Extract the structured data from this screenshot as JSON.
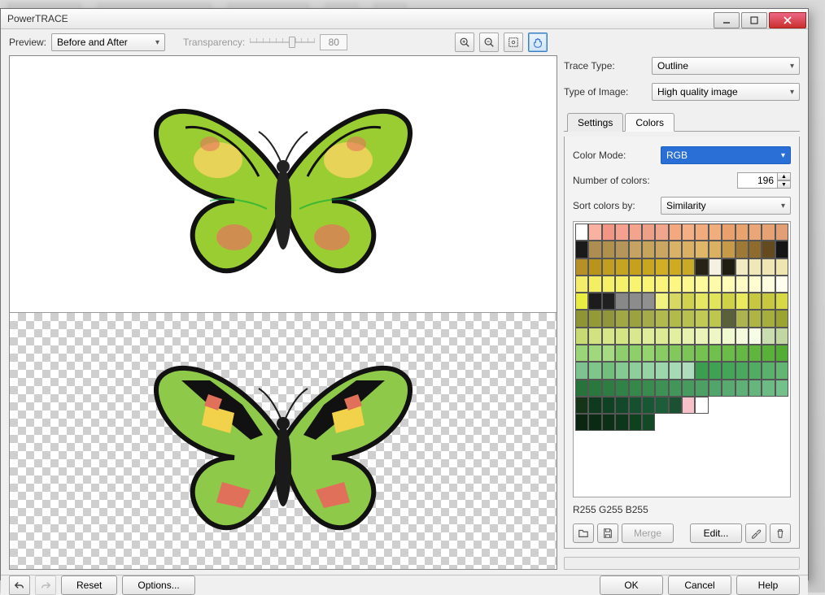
{
  "window": {
    "title": "PowerTRACE"
  },
  "toolbar": {
    "preview_label": "Preview:",
    "preview_value": "Before and After",
    "transparency_label": "Transparency:",
    "transparency_value": "80"
  },
  "right": {
    "trace_type_label": "Trace Type:",
    "trace_type_value": "Outline",
    "image_type_label": "Type of Image:",
    "image_type_value": "High quality image",
    "tab_settings": "Settings",
    "tab_colors": "Colors",
    "color_mode_label": "Color Mode:",
    "color_mode_value": "RGB",
    "num_colors_label": "Number of colors:",
    "num_colors_value": "196",
    "sort_label": "Sort colors by:",
    "sort_value": "Similarity",
    "status_text": "R255 G255 B255",
    "merge_label": "Merge",
    "edit_label": "Edit..."
  },
  "footer": {
    "reset": "Reset",
    "options": "Options...",
    "ok": "OK",
    "cancel": "Cancel",
    "help": "Help"
  },
  "palette": [
    "#ffffff",
    "#f9b2a2",
    "#f39584",
    "#f6a090",
    "#f4a38e",
    "#ee9f87",
    "#f1a58c",
    "#f3a880",
    "#f4b084",
    "#f2ab7c",
    "#f0ad7e",
    "#eaa06d",
    "#e9a36f",
    "#eaa676",
    "#e6a273",
    "#e29e74",
    "#1a1a1a",
    "#ad8d52",
    "#b0904d",
    "#b5955a",
    "#c6a363",
    "#c7a45b",
    "#cba660",
    "#dab267",
    "#d9b064",
    "#e0b668",
    "#dab163",
    "#c69a48",
    "#9e7a36",
    "#8f6c2e",
    "#644a1f",
    "#151515",
    "#b68f26",
    "#b8941c",
    "#c19e22",
    "#c5a421",
    "#c7a11e",
    "#c9a620",
    "#d2ae24",
    "#cfab22",
    "#c9a925",
    "#272116",
    "#f4f0e2",
    "#1f1d11",
    "#f2eac3",
    "#efe7b8",
    "#f0e6b5",
    "#efe5b0",
    "#f3ed6b",
    "#f3ee63",
    "#f5f067",
    "#f6f16b",
    "#f8f370",
    "#f9f474",
    "#faf57a",
    "#fbf782",
    "#fcf88e",
    "#fdfa9c",
    "#fdfba9",
    "#fefcb7",
    "#fefcc5",
    "#fefdd2",
    "#fefde0",
    "#fffeef",
    "#e9ed42",
    "#1c1c1c",
    "#202020",
    "#888888",
    "#8c8c8c",
    "#909090",
    "#f1f380",
    "#d7d861",
    "#d0d14e",
    "#e5e762",
    "#e2e45c",
    "#cfd247",
    "#e9eb5c",
    "#c7c840",
    "#c7c83f",
    "#d7d845",
    "#8f9435",
    "#949a37",
    "#909639",
    "#a0a743",
    "#9ca23e",
    "#a5ab49",
    "#b2ba4d",
    "#b2bb4a",
    "#b8c14e",
    "#c1ca55",
    "#bdc74f",
    "#5a603a",
    "#acb34f",
    "#aeb544",
    "#a6af3e",
    "#9ba430",
    "#c8db73",
    "#d2e280",
    "#d7e688",
    "#d4e583",
    "#d9e88f",
    "#dfec9a",
    "#dceb94",
    "#e2efa1",
    "#e6f2ad",
    "#eaf4b8",
    "#eef6c5",
    "#f1f9d0",
    "#f4fadb",
    "#f7fce7",
    "#caddb1",
    "#c1d6a3",
    "#9bd578",
    "#a1d87e",
    "#a6db84",
    "#8fce6c",
    "#8fcf6a",
    "#95d36f",
    "#89cc63",
    "#82c85c",
    "#7cc457",
    "#76c251",
    "#71bf4d",
    "#6bbb48",
    "#65b843",
    "#5fb53e",
    "#59b139",
    "#53ad34",
    "#7ec28f",
    "#7fc68b",
    "#71be7d",
    "#86ca93",
    "#8dce9b",
    "#96d2a3",
    "#9dd6ac",
    "#a5dab4",
    "#aeddbd",
    "#3a9d4f",
    "#3ea153",
    "#43a558",
    "#4aa95e",
    "#52ad64",
    "#5ab16b",
    "#63b572",
    "#28733b",
    "#2b783e",
    "#2e7c42",
    "#318246",
    "#35874a",
    "#398c4e",
    "#3e9154",
    "#429659",
    "#479b5e",
    "#4da064",
    "#52a56a",
    "#58aa70",
    "#5fb077",
    "#65b57d",
    "#6cba84",
    "#73c08b",
    "#153418",
    "#103a20",
    "#0f4222",
    "#13492a",
    "#16502f",
    "#185634",
    "#1d5d39",
    "#1c5032",
    "#f7c1c9",
    "#ffffff",
    "",
    "",
    "",
    "",
    "",
    "",
    "#0a2510",
    "#0b2a13",
    "#0c3016",
    "#0e361a",
    "#10411f",
    "#144827",
    "",
    "",
    "",
    "",
    "",
    "",
    "",
    "",
    "",
    ""
  ]
}
